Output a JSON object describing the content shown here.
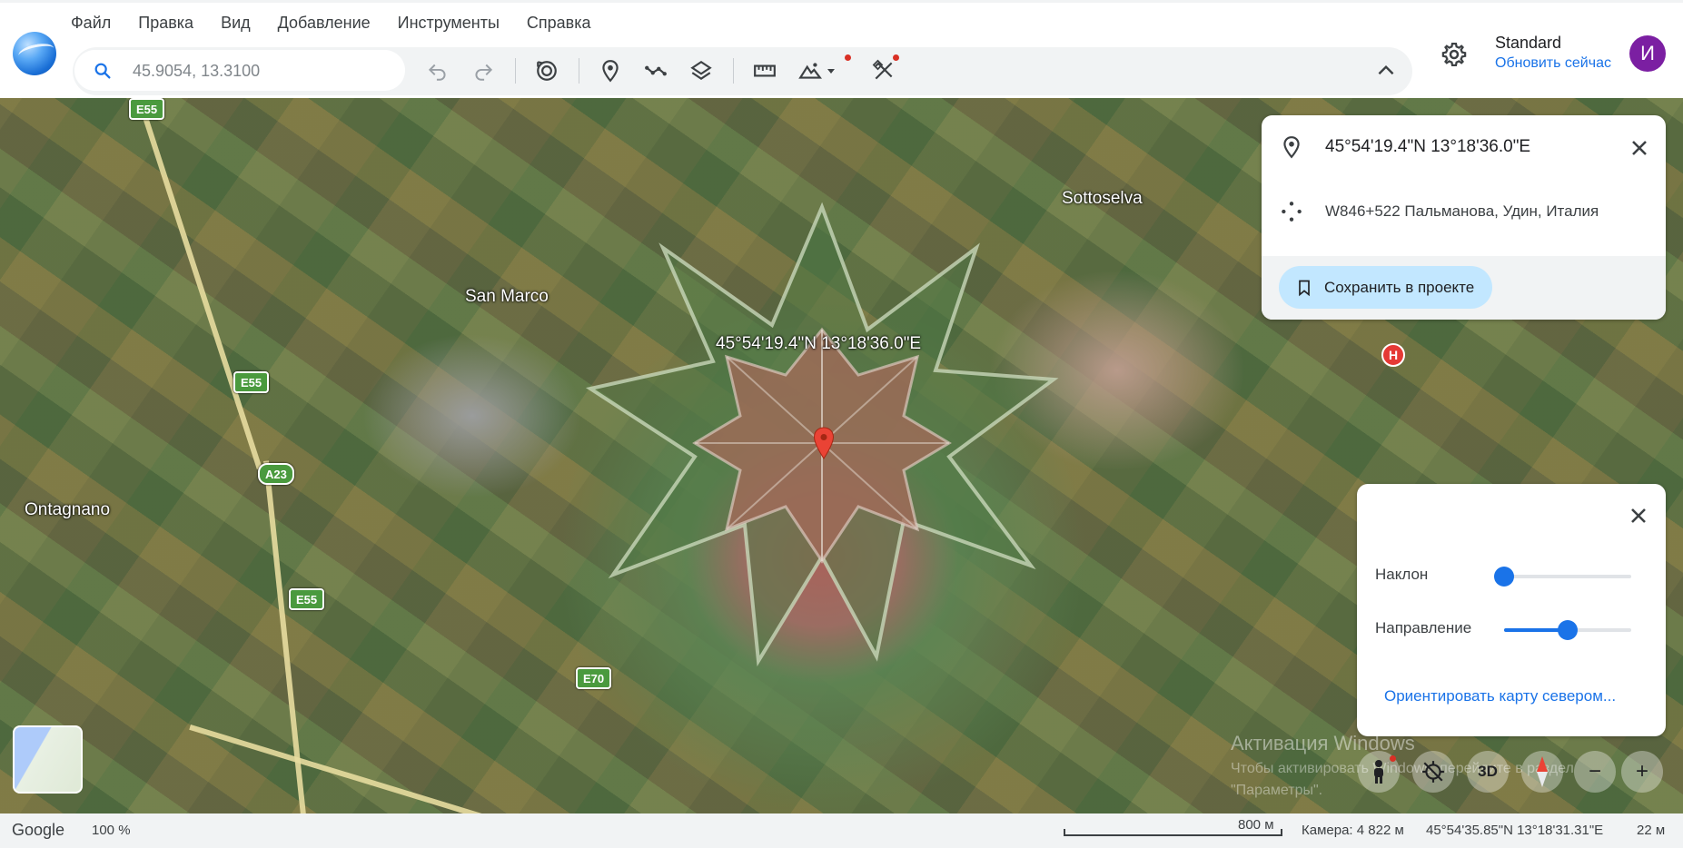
{
  "menu": [
    "Файл",
    "Правка",
    "Вид",
    "Добавление",
    "Инструменты",
    "Справка"
  ],
  "search": {
    "placeholder": "45.9054, 13.3100"
  },
  "toolbar": {
    "icons": [
      "undo-icon",
      "redo-icon",
      "historical-imagery-icon",
      "add-placemark-icon",
      "add-path-icon",
      "layers-icon",
      "measure-icon",
      "terrain-icon",
      "draw-tool-icon",
      "collapse-icon"
    ]
  },
  "account": {
    "plan": "Standard",
    "update_link": "Обновить сейчас",
    "avatar_letter": "И"
  },
  "map": {
    "labels": [
      "San Marco",
      "Sottoselva",
      "Ontagnano"
    ],
    "pin_label": "45°54'19.4\"N 13°18'36.0\"E",
    "roads": [
      "E55",
      "E55",
      "A23",
      "E55",
      "E70"
    ],
    "hospital_badge": "H"
  },
  "info_card": {
    "coordinates": "45°54'19.4\"N 13°18'36.0\"E",
    "plus_code": "W846+522 Пальманова, Удин, Италия",
    "save_button": "Сохранить в проекте"
  },
  "view_panel": {
    "tilt_label": "Наклон",
    "tilt_value": 0.0,
    "heading_label": "Направление",
    "heading_value": 0.5,
    "north_link": "Ориентировать карту севером..."
  },
  "controls": {
    "three_d": "3D",
    "zoom_out": "−",
    "zoom_in": "+"
  },
  "watermark": {
    "line1": "Активация Windows",
    "line2": "Чтобы активировать Windows, перейдите в раздел",
    "line3": "\"Параметры\"."
  },
  "status": {
    "brand": "Google",
    "zoom": "100 %",
    "scale": "800 м",
    "camera": "Камера: 4 822 м",
    "cursor": "45°54'35.85\"N 13°18'31.31\"E",
    "elevation": "22 м"
  },
  "colors": {
    "accent": "#1a73e8",
    "avatar": "#7b1fa2",
    "save_bg": "#c2e7ff",
    "pin": "#ea4335"
  }
}
